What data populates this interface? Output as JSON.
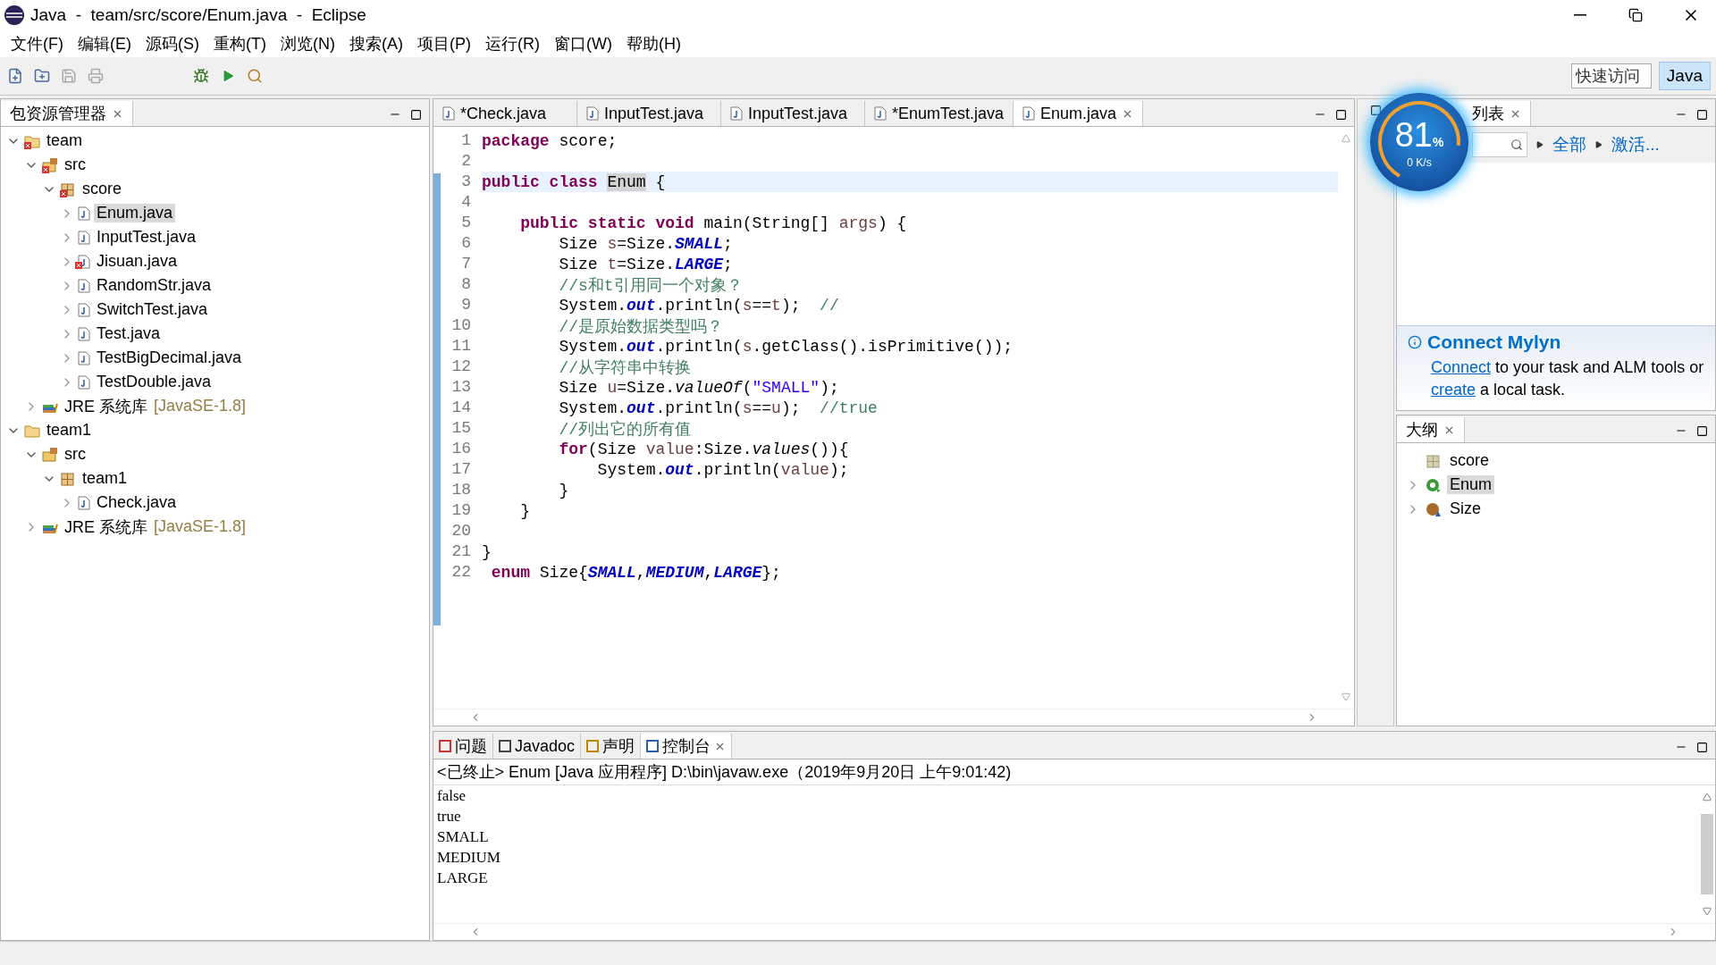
{
  "window": {
    "title": "Java  -  team/src/score/Enum.java  -  Eclipse"
  },
  "menu": [
    "文件(F)",
    "编辑(E)",
    "源码(S)",
    "重构(T)",
    "浏览(N)",
    "搜索(A)",
    "项目(P)",
    "运行(R)",
    "窗口(W)",
    "帮助(H)"
  ],
  "quick_access": {
    "placeholder": "快速访问"
  },
  "perspective": {
    "label": "Java",
    "selected": true
  },
  "package_explorer": {
    "title": "包资源管理器",
    "tree": [
      {
        "label": "team",
        "kind": "project",
        "error": true,
        "expanded": true,
        "selected": false,
        "children": [
          {
            "label": "src",
            "kind": "source",
            "error": true,
            "expanded": true,
            "selected": false,
            "children": [
              {
                "label": "score",
                "kind": "package",
                "error": true,
                "expanded": true,
                "selected": false,
                "children": [
                  {
                    "label": "Enum.java",
                    "kind": "file",
                    "error": false,
                    "expanded": false,
                    "selected": true
                  },
                  {
                    "label": "InputTest.java",
                    "kind": "file",
                    "error": false,
                    "expanded": false,
                    "selected": false
                  },
                  {
                    "label": "Jisuan.java",
                    "kind": "file",
                    "error": true,
                    "expanded": false,
                    "selected": false
                  },
                  {
                    "label": "RandomStr.java",
                    "kind": "file",
                    "error": false,
                    "expanded": false,
                    "selected": false
                  },
                  {
                    "label": "SwitchTest.java",
                    "kind": "file",
                    "error": false,
                    "expanded": false,
                    "selected": false
                  },
                  {
                    "label": "Test.java",
                    "kind": "file",
                    "error": false,
                    "expanded": false,
                    "selected": false
                  },
                  {
                    "label": "TestBigDecimal.java",
                    "kind": "file",
                    "error": false,
                    "expanded": false,
                    "selected": false
                  },
                  {
                    "label": "TestDouble.java",
                    "kind": "file",
                    "error": false,
                    "expanded": false,
                    "selected": false
                  }
                ]
              }
            ]
          },
          {
            "label": "JRE 系统库",
            "suffix": "[JavaSE-1.8]",
            "kind": "library",
            "error": false,
            "expanded": false,
            "selected": false
          }
        ]
      },
      {
        "label": "team1",
        "kind": "project",
        "error": false,
        "expanded": true,
        "selected": false,
        "children": [
          {
            "label": "src",
            "kind": "source",
            "error": false,
            "expanded": true,
            "selected": false,
            "children": [
              {
                "label": "team1",
                "kind": "package",
                "error": false,
                "expanded": true,
                "selected": false,
                "children": [
                  {
                    "label": "Check.java",
                    "kind": "file",
                    "error": false,
                    "expanded": false,
                    "selected": false
                  }
                ]
              }
            ]
          },
          {
            "label": "JRE 系统库",
            "suffix": "[JavaSE-1.8]",
            "kind": "library",
            "error": false,
            "expanded": false,
            "selected": false
          }
        ]
      }
    ]
  },
  "editor": {
    "tabs": [
      {
        "label": "*Check.java",
        "selected": false
      },
      {
        "label": "InputTest.java",
        "selected": false
      },
      {
        "label": "InputTest.java",
        "selected": false
      },
      {
        "label": "*EnumTest.java",
        "selected": false
      },
      {
        "label": "Enum.java",
        "selected": true
      }
    ],
    "lines": [
      {
        "no": "1",
        "current": false,
        "tokens": [
          {
            "t": "package",
            "kind": "kw"
          },
          {
            "t": " score;",
            "kind": "plain"
          }
        ]
      },
      {
        "no": "2",
        "current": false
      },
      {
        "no": "3",
        "current": true,
        "tokens": [
          {
            "t": "public",
            "kind": "kw"
          },
          {
            "t": " class ",
            "kind": "kw"
          },
          {
            "t": "Enum",
            "kind": "mark"
          },
          {
            "t": " {",
            "kind": "plain"
          }
        ]
      },
      {
        "no": "4",
        "current": false
      },
      {
        "no": "5",
        "current": false,
        "tokens": [
          {
            "t": "    public",
            "kind": "kw"
          },
          {
            "t": " static",
            "kind": "kw"
          },
          {
            "t": " void",
            "kind": "kw"
          },
          {
            "t": " main(String[] ",
            "kind": "plain"
          },
          {
            "t": "args",
            "kind": "var"
          },
          {
            "t": ") {",
            "kind": "plain"
          }
        ]
      },
      {
        "no": "6",
        "current": false,
        "tokens": [
          {
            "t": "        Size ",
            "kind": "plain"
          },
          {
            "t": "s",
            "kind": "var"
          },
          {
            "t": "=Size.",
            "kind": "plain"
          },
          {
            "t": "SMALL",
            "kind": "field"
          },
          {
            "t": ";",
            "kind": "plain"
          }
        ]
      },
      {
        "no": "7",
        "current": false,
        "tokens": [
          {
            "t": "        Size ",
            "kind": "plain"
          },
          {
            "t": "t",
            "kind": "var"
          },
          {
            "t": "=Size.",
            "kind": "plain"
          },
          {
            "t": "LARGE",
            "kind": "field"
          },
          {
            "t": ";",
            "kind": "plain"
          }
        ]
      },
      {
        "no": "8",
        "current": false,
        "tokens": [
          {
            "t": "        //s和t引用同一个对象？",
            "kind": "comment"
          }
        ]
      },
      {
        "no": "9",
        "current": false,
        "tokens": [
          {
            "t": "        System.",
            "kind": "plain"
          },
          {
            "t": "out",
            "kind": "field"
          },
          {
            "t": ".println(",
            "kind": "plain"
          },
          {
            "t": "s",
            "kind": "var"
          },
          {
            "t": "==",
            "kind": "plain"
          },
          {
            "t": "t",
            "kind": "var"
          },
          {
            "t": ");  ",
            "kind": "plain"
          },
          {
            "t": "//",
            "kind": "comment"
          }
        ]
      },
      {
        "no": "10",
        "current": false,
        "tokens": [
          {
            "t": "        //是原始数据类型吗？",
            "kind": "comment"
          }
        ]
      },
      {
        "no": "11",
        "current": false,
        "tokens": [
          {
            "t": "        System.",
            "kind": "plain"
          },
          {
            "t": "out",
            "kind": "field"
          },
          {
            "t": ".println(",
            "kind": "plain"
          },
          {
            "t": "s",
            "kind": "var"
          },
          {
            "t": ".getClass().isPrimitive());",
            "kind": "plain"
          }
        ]
      },
      {
        "no": "12",
        "current": false,
        "tokens": [
          {
            "t": "        //从字符串中转换",
            "kind": "comment"
          }
        ]
      },
      {
        "no": "13",
        "current": false,
        "tokens": [
          {
            "t": "        Size ",
            "kind": "plain"
          },
          {
            "t": "u",
            "kind": "var"
          },
          {
            "t": "=Size.",
            "kind": "plain"
          },
          {
            "t": "valueOf",
            "kind": "static"
          },
          {
            "t": "(",
            "kind": "plain"
          },
          {
            "t": "\"SMALL\"",
            "kind": "string"
          },
          {
            "t": ");",
            "kind": "plain"
          }
        ]
      },
      {
        "no": "14",
        "current": false,
        "tokens": [
          {
            "t": "        System.",
            "kind": "plain"
          },
          {
            "t": "out",
            "kind": "field"
          },
          {
            "t": ".println(",
            "kind": "plain"
          },
          {
            "t": "s",
            "kind": "var"
          },
          {
            "t": "==",
            "kind": "plain"
          },
          {
            "t": "u",
            "kind": "var"
          },
          {
            "t": ");  ",
            "kind": "plain"
          },
          {
            "t": "//true",
            "kind": "comment"
          }
        ]
      },
      {
        "no": "15",
        "current": false,
        "tokens": [
          {
            "t": "        //列出它的所有值",
            "kind": "comment"
          }
        ]
      },
      {
        "no": "16",
        "current": false,
        "tokens": [
          {
            "t": "        for",
            "kind": "kw"
          },
          {
            "t": "(Size ",
            "kind": "plain"
          },
          {
            "t": "value",
            "kind": "var"
          },
          {
            "t": ":Size.",
            "kind": "plain"
          },
          {
            "t": "values",
            "kind": "static"
          },
          {
            "t": "()){",
            "kind": "plain"
          }
        ]
      },
      {
        "no": "17",
        "current": false,
        "tokens": [
          {
            "t": "            System.",
            "kind": "plain"
          },
          {
            "t": "out",
            "kind": "field"
          },
          {
            "t": ".println(",
            "kind": "plain"
          },
          {
            "t": "value",
            "kind": "var"
          },
          {
            "t": ");",
            "kind": "plain"
          }
        ]
      },
      {
        "no": "18",
        "current": false,
        "tokens": [
          {
            "t": "        }",
            "kind": "plain"
          }
        ]
      },
      {
        "no": "19",
        "current": false,
        "tokens": [
          {
            "t": "    }",
            "kind": "plain"
          }
        ]
      },
      {
        "no": "20",
        "current": false
      },
      {
        "no": "21",
        "current": false,
        "tokens": [
          {
            "t": "}",
            "kind": "plain"
          }
        ]
      },
      {
        "no": "22",
        "current": false,
        "tokens": [
          {
            "t": " enum",
            "kind": "kw"
          },
          {
            "t": " Size{",
            "kind": "plain"
          },
          {
            "t": "SMALL",
            "kind": "field"
          },
          {
            "t": ",",
            "kind": "plain"
          },
          {
            "t": "MEDIUM",
            "kind": "field"
          },
          {
            "t": ",",
            "kind": "plain"
          },
          {
            "t": "LARGE",
            "kind": "field"
          },
          {
            "t": "};",
            "kind": "plain"
          }
        ]
      }
    ]
  },
  "task_list": {
    "title": "列表",
    "links": [
      "全部",
      "激活..."
    ]
  },
  "mylyn": {
    "title": "Connect Mylyn",
    "parts": [
      {
        "text": "Connect",
        "link": true
      },
      {
        "text": " to your task and ALM tools or ",
        "link": false
      },
      {
        "text": "create",
        "link": true
      },
      {
        "text": " a local task.",
        "link": false
      }
    ]
  },
  "outline": {
    "title": "大纲",
    "items": [
      {
        "label": "score",
        "kind": "package",
        "selected": false
      },
      {
        "label": "Enum",
        "kind": "class",
        "selected": true
      },
      {
        "label": "Size",
        "kind": "enum",
        "selected": false
      }
    ]
  },
  "monitor": {
    "percent": "81",
    "unit": "%",
    "speed": "0 K/s"
  },
  "console": {
    "tabs": [
      {
        "label": "问题",
        "kind": "problems",
        "selected": false
      },
      {
        "label": "Javadoc",
        "kind": "javadoc",
        "selected": false
      },
      {
        "label": "声明",
        "kind": "declaration",
        "selected": false
      },
      {
        "label": "控制台",
        "kind": "console",
        "selected": true
      }
    ],
    "header": "<已终止> Enum [Java 应用程序] D:\\bin\\javaw.exe（2019年9月20日 上午9:01:42)",
    "output": [
      "false",
      "true",
      "SMALL",
      "MEDIUM",
      "LARGE"
    ]
  }
}
